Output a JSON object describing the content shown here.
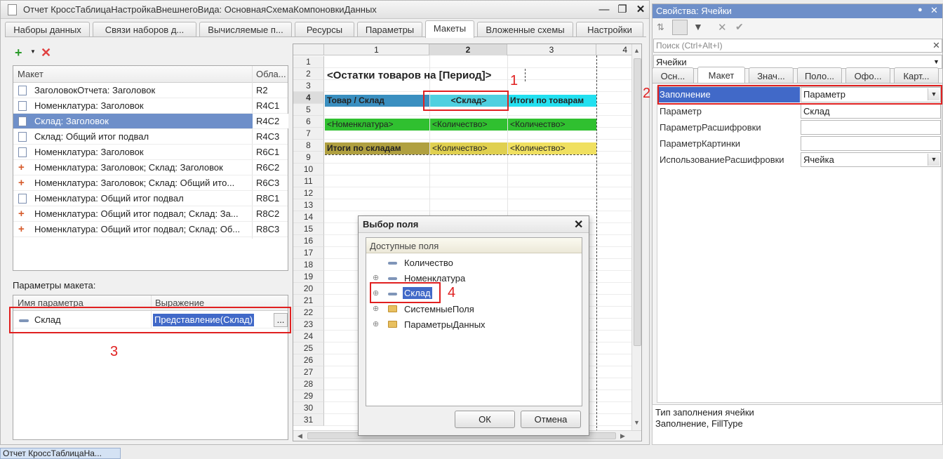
{
  "window": {
    "title": "Отчет КроссТаблицаНастройкаВнешнегоВида: ОсновнаяСхемаКомпоновкиДанных"
  },
  "tabs": [
    "Наборы данных",
    "Связи наборов д...",
    "Вычисляемые п...",
    "Ресурсы",
    "Параметры",
    "Макеты",
    "Вложенные схемы",
    "Настройки"
  ],
  "layouts": {
    "col_layout": "Макет",
    "col_area": "Обла...",
    "rows": [
      {
        "name": "ЗаголовокОтчета: Заголовок",
        "area": "R2"
      },
      {
        "name": "Номенклатура: Заголовок",
        "area": "R4C1"
      },
      {
        "name": "Склад: Заголовок",
        "area": "R4C2"
      },
      {
        "name": "Склад: Общий итог подвал",
        "area": "R4C3"
      },
      {
        "name": "Номенклатура: Заголовок",
        "area": "R6C1"
      },
      {
        "name": "Номенклатура: Заголовок; Склад: Заголовок",
        "area": "R6C2"
      },
      {
        "name": "Номенклатура: Заголовок; Склад: Общий ито...",
        "area": "R6C3"
      },
      {
        "name": "Номенклатура: Общий итог подвал",
        "area": "R8C1"
      },
      {
        "name": "Номенклатура: Общий итог подвал; Склад: За...",
        "area": "R8C2"
      },
      {
        "name": "Номенклатура: Общий итог подвал; Склад: Об...",
        "area": "R8C3"
      }
    ]
  },
  "params": {
    "section_label": "Параметры макета:",
    "col_name": "Имя параметра",
    "col_expr": "Выражение",
    "row": {
      "name": "Склад",
      "expr": "Представление(Склад)",
      "more": "..."
    }
  },
  "sheet": {
    "col_headers": [
      "1",
      "2",
      "3",
      "4"
    ],
    "row_numbers": [
      "1",
      "2",
      "3",
      "4",
      "5",
      "6",
      "7",
      "8",
      "9",
      "10",
      "11",
      "12",
      "13",
      "14",
      "15",
      "16",
      "17",
      "18",
      "19",
      "20",
      "21",
      "22",
      "23",
      "24",
      "25",
      "26",
      "27",
      "28",
      "29",
      "30",
      "31"
    ],
    "title": "<Остатки товаров на [Период]>",
    "r4": [
      "Товар / Склад",
      "<Склад>",
      "Итоги по товарам"
    ],
    "r6": [
      "<Номенклатура>",
      "<Количество>",
      "<Количество>"
    ],
    "r8": [
      "Итоги по складам",
      "<Количество>",
      "<Количество>"
    ]
  },
  "dialog": {
    "title": "Выбор поля",
    "group": "Доступные поля",
    "items": [
      "Количество",
      "Номенклатура",
      "Склад",
      "СистемныеПоля",
      "ПараметрыДанных"
    ],
    "ok": "ОК",
    "cancel": "Отмена"
  },
  "props": {
    "title": "Свойства: Ячейки",
    "search_placeholder": "Поиск (Ctrl+Alt+I)",
    "object": "Ячейки",
    "tabs": [
      "Осн...",
      "Макет",
      "Знач...",
      "Поло...",
      "Офо...",
      "Карт..."
    ],
    "rows": [
      {
        "label": "Заполнение",
        "value": "Параметр"
      },
      {
        "label": "Параметр",
        "value": "Склад"
      },
      {
        "label": "ПараметрРасшифровки",
        "value": ""
      },
      {
        "label": "ПараметрКартинки",
        "value": ""
      },
      {
        "label": "ИспользованиеРасшифровки",
        "value": "Ячейка"
      }
    ],
    "desc1": "Тип заполнения ячейки",
    "desc2": "Заполнение, FillType"
  },
  "annotations": [
    "1",
    "2",
    "3",
    "4"
  ],
  "taskbar": {
    "label": "Отчет КроссТаблицаНа..."
  },
  "colors": {
    "r4a": "#3a8fc0",
    "r4b": "#4fd0e0",
    "r4c": "#22e0f0",
    "r6": "#30c030",
    "r8a": "#b0a040",
    "r8b": "#e0d050",
    "accent": "#6e8fc9",
    "red": "#e02020"
  }
}
